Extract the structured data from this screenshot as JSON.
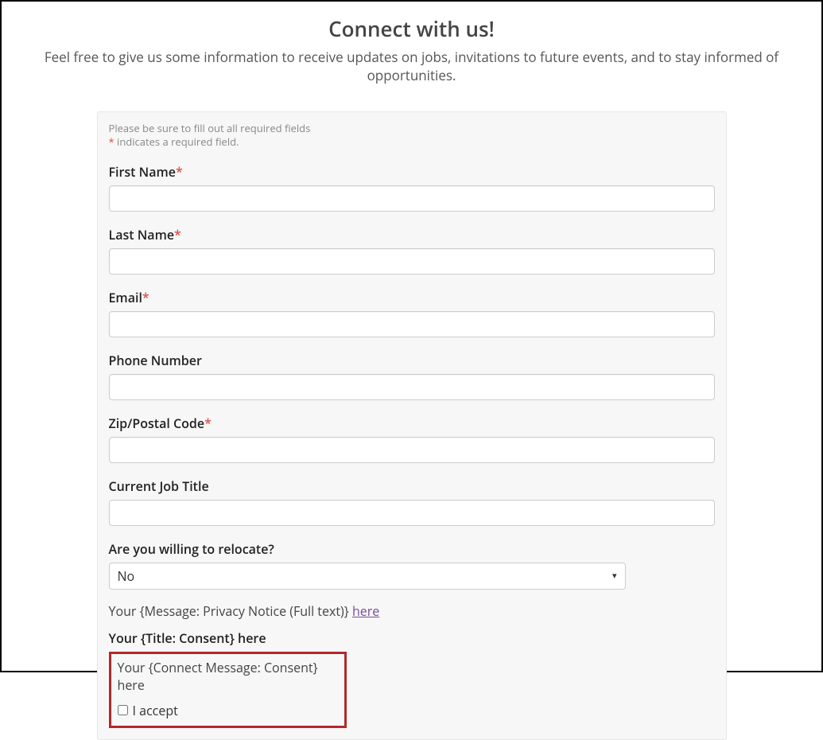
{
  "header": {
    "title": "Connect with us!",
    "subtitle": "Feel free to give us some information to receive updates on jobs, invitations to future events, and to stay informed of opportunities."
  },
  "notice": {
    "line1": "Please be sure to fill out all required fields",
    "star": "*",
    "line2_rest": " indicates a required field."
  },
  "fields": {
    "first_name": {
      "label": "First Name",
      "required": true,
      "value": ""
    },
    "last_name": {
      "label": "Last Name",
      "required": true,
      "value": ""
    },
    "email": {
      "label": "Email",
      "required": true,
      "value": ""
    },
    "phone": {
      "label": "Phone Number",
      "required": false,
      "value": ""
    },
    "zip": {
      "label": "Zip/Postal Code",
      "required": true,
      "value": ""
    },
    "job_title": {
      "label": "Current Job Title",
      "required": false,
      "value": ""
    },
    "relocate": {
      "label": "Are you willing to relocate?",
      "selected": "No"
    }
  },
  "privacy": {
    "prefix": "Your {Message: Privacy Notice (Full text)} ",
    "link_text": "here"
  },
  "consent": {
    "title": "Your {Title: Consent} here",
    "message": "Your {Connect Message: Consent} here",
    "accept_label": "I accept",
    "accepted": false
  },
  "required_marker": "*"
}
